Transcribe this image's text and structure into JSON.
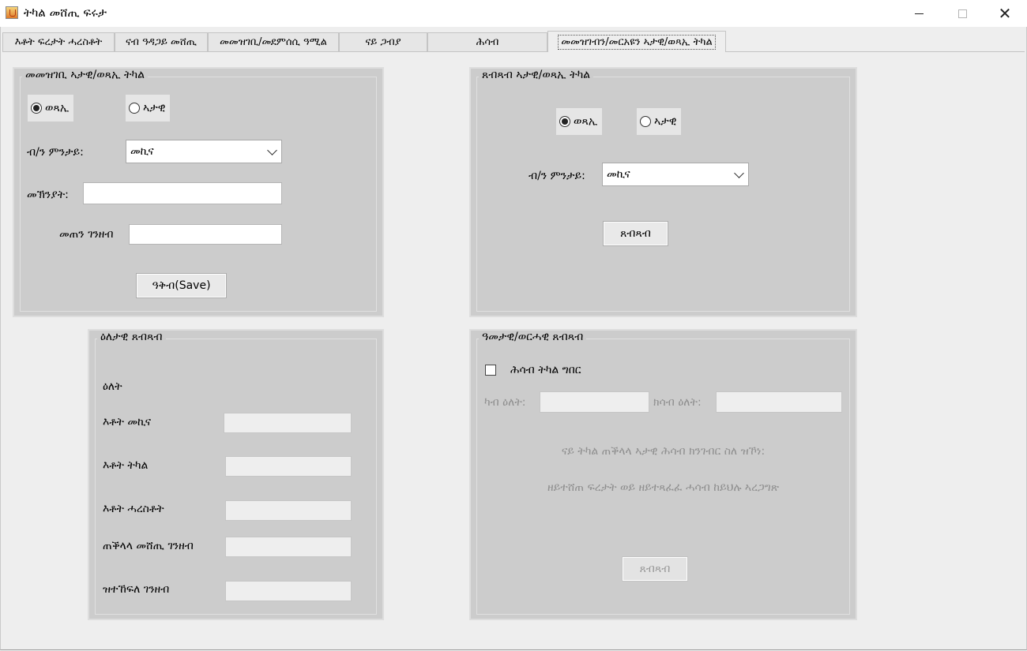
{
  "window": {
    "title": "ትካል መሸጢ ፍሩታ",
    "icon": "java-app-icon",
    "controls": [
      "minimize-icon",
      "maximize-icon",
      "close-icon"
    ]
  },
  "tabs": [
    {
      "label": "እቶት ፍረታት ሓረስቶት",
      "active": false
    },
    {
      "label": "ናብ ዓዳጋይ መሸጢ",
      "active": false
    },
    {
      "label": "መመዝገቢ/መደምሰሲ ዓሚል",
      "active": false
    },
    {
      "label": "ናይ ጋብያ",
      "active": false
    },
    {
      "label": "ሕሳብ",
      "active": false
    },
    {
      "label": "መመዝገብን/መርአዩን ኣታዊ/ወጻኢ ትካል",
      "active": true
    }
  ],
  "register_panel": {
    "title": "መመዝገቢ ኣታዊ/ወጻኢ ትካል",
    "radio_expense": "ወጻኢ",
    "radio_income": "ኣታዊ",
    "selected": "ወጻኢ",
    "type_label": "ብ/ን ምንታይ:",
    "type_value": "መኪና",
    "reason_label": "መኽንያት:",
    "reason_value": "",
    "amount_label": "መጠን ገንዘብ",
    "amount_value": "",
    "save_label": "ዓቅብ(Save)"
  },
  "report_panel": {
    "title": "ጸብጻብ ኣታዊ/ወጻኢ ትካል",
    "radio_expense": "ወጻኢ",
    "radio_income": "ኣታዊ",
    "selected": "ወጻኢ",
    "type_label": "ብ/ን ምንታይ:",
    "type_value": "መኪና",
    "report_button": "ጸብጻብ"
  },
  "daily_panel": {
    "title": "ዕለታዊ ጸብጻብ",
    "date_label": "ዕለት",
    "rows": [
      {
        "label": "እቶት መኪና",
        "value": ""
      },
      {
        "label": "እቶት ትካል",
        "value": ""
      },
      {
        "label": "እቶት ሓረስቶት",
        "value": ""
      },
      {
        "label": "ጠቕላላ መሸጢ ገንዘብ",
        "value": ""
      },
      {
        "label": "ዝተኸፍለ ገንዘብ",
        "value": ""
      }
    ]
  },
  "period_panel": {
    "title": "ዓመታዊ/ወርሓዊ ጸብጻብ",
    "checkbox_label": "ሕሳብ ትካል ግበር",
    "checkbox_checked": false,
    "from_label": "ካብ ዕለት:",
    "from_value": "",
    "to_label": "ክሳብ ዕለት:",
    "to_value": "",
    "note_line1": "ናይ ትካል ጠቕላላ ኣታዊ ሕሳብ ክንገብር ስለ ዝኾነ:",
    "note_line2": "ዘይተሸጠ ፍረታት ወይ ዘይተጻፈፈ ሓሳብ ከይህሉ ኣረጋግጽ",
    "report_button": "ጸብጻብ"
  }
}
